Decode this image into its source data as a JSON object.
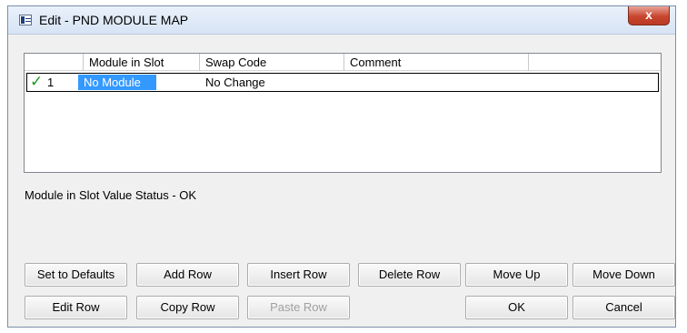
{
  "window": {
    "title": "Edit - PND MODULE MAP",
    "close_label": "x"
  },
  "grid": {
    "columns": [
      "",
      "Module in Slot",
      "Swap Code",
      "Comment",
      ""
    ],
    "rows": [
      {
        "status": "✓",
        "number": "1",
        "module": "No Module",
        "swap_code": "No Change",
        "comment": ""
      }
    ]
  },
  "status_text": "Module in Slot Value Status - OK",
  "buttons": {
    "set_defaults": "Set to Defaults",
    "add_row": "Add Row",
    "insert_row": "Insert Row",
    "delete_row": "Delete Row",
    "move_up": "Move Up",
    "move_down": "Move Down",
    "edit_row": "Edit Row",
    "copy_row": "Copy Row",
    "paste_row": "Paste Row",
    "ok": "OK",
    "cancel": "Cancel"
  }
}
